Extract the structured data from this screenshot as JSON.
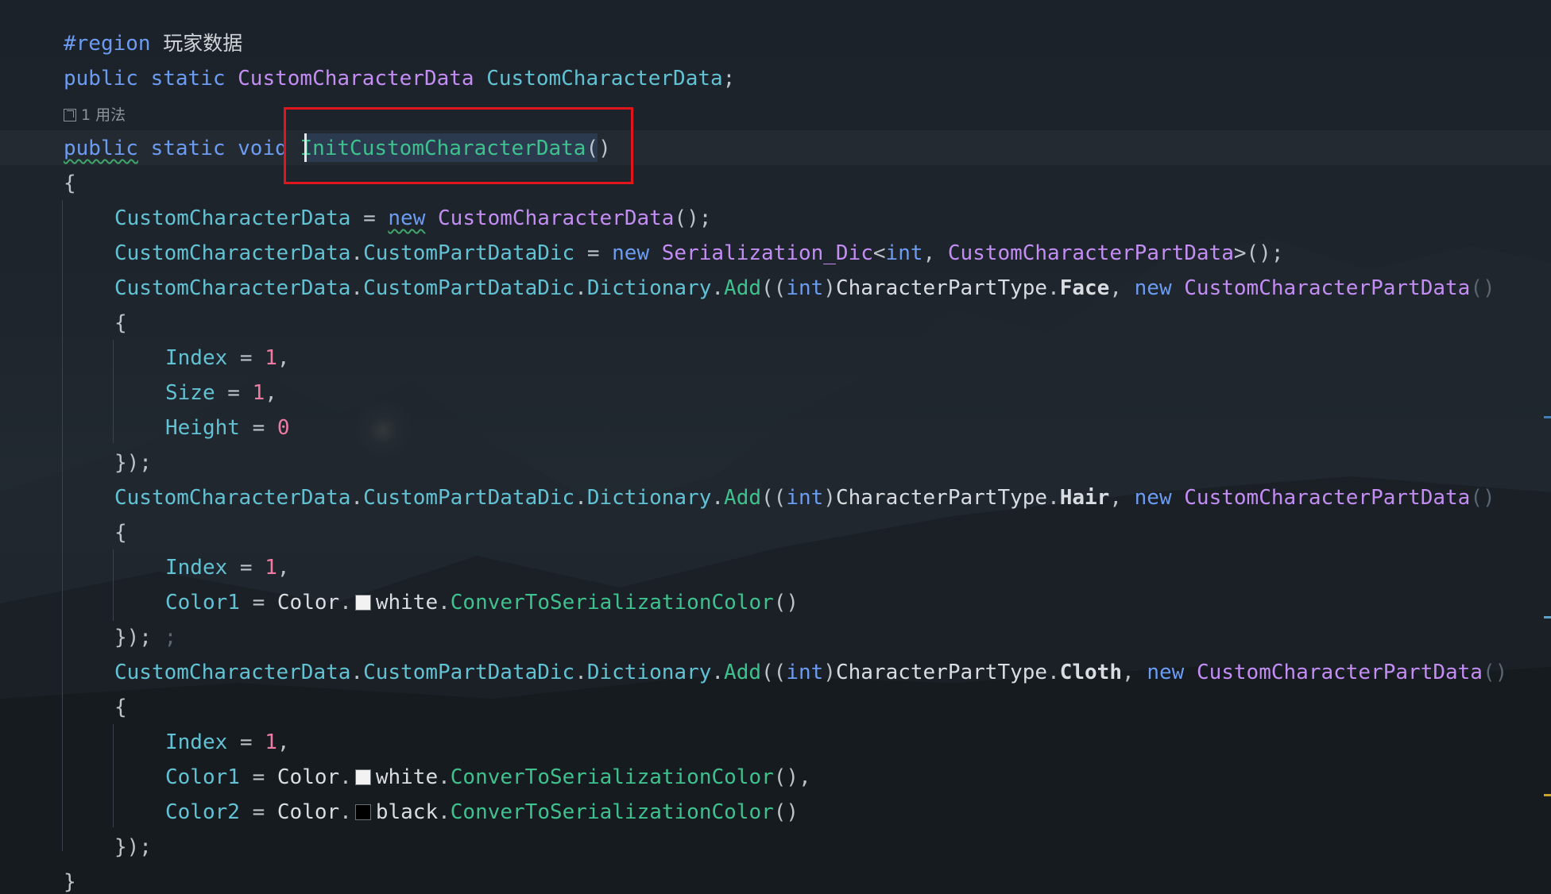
{
  "editor": {
    "region": {
      "directive": "#region",
      "label": "玩家数据"
    },
    "field_decl": {
      "mod1": "public",
      "mod2": "static",
      "type": "CustomCharacterData",
      "name": "CustomCharacterData",
      "end": ";"
    },
    "usage_hint": "1 用法",
    "method_decl": {
      "mod1": "public",
      "mod2": "static",
      "ret": "void",
      "name": "InitCustomCharacterData",
      "parens": "()"
    },
    "open_brace": "{",
    "close_brace": "}",
    "assign_new": {
      "lhs": "CustomCharacterData",
      "op": " = ",
      "kw": "new",
      "type": "CustomCharacterData",
      "end": "();"
    },
    "dic_init": {
      "obj": "CustomCharacterData",
      "dot": ".",
      "prop": "CustomPartDataDic",
      "op": " = ",
      "kw": "new",
      "type": "Serialization_Dic",
      "lt": "<",
      "int": "int",
      "comma": ", ",
      "type2": "CustomCharacterPartData",
      "end": ">();"
    },
    "add_calls": [
      {
        "obj": "CustomCharacterData",
        "prop": "CustomPartDataDic",
        "prop2": "Dictionary",
        "meth": "Add",
        "cast_open": "((",
        "int": "int",
        "cast_close": ")",
        "enum": "CharacterPartType",
        "member": "Face",
        "kw": "new",
        "type": "CustomCharacterPartData",
        "end": "()"
      },
      {
        "obj": "CustomCharacterData",
        "prop": "CustomPartDataDic",
        "prop2": "Dictionary",
        "meth": "Add",
        "cast_open": "((",
        "int": "int",
        "cast_close": ")",
        "enum": "CharacterPartType",
        "member": "Hair",
        "kw": "new",
        "type": "CustomCharacterPartData",
        "end": "()"
      },
      {
        "obj": "CustomCharacterData",
        "prop": "CustomPartDataDic",
        "prop2": "Dictionary",
        "meth": "Add",
        "cast_open": "((",
        "int": "int",
        "cast_close": ")",
        "enum": "CharacterPartType",
        "member": "Cloth",
        "kw": "new",
        "type": "CustomCharacterPartData",
        "end": "()"
      }
    ],
    "face_props": [
      {
        "name": "Index",
        "op": " = ",
        "val": "1",
        "end": ","
      },
      {
        "name": "Size",
        "op": " = ",
        "val": "1",
        "end": ","
      },
      {
        "name": "Height",
        "op": " = ",
        "val": "0",
        "end": ""
      }
    ],
    "hair_props": {
      "index": {
        "name": "Index",
        "op": " = ",
        "val": "1",
        "end": ","
      },
      "color1": {
        "name": "Color1",
        "op": " = ",
        "cls": "Color",
        "dot": ".",
        "color": "white",
        "meth": "ConverToSerializationColor",
        "end": "()"
      }
    },
    "cloth_props": {
      "index": {
        "name": "Index",
        "op": " = ",
        "val": "1",
        "end": ","
      },
      "color1": {
        "name": "Color1",
        "op": " = ",
        "cls": "Color",
        "dot": ".",
        "color": "white",
        "meth": "ConverToSerializationColor",
        "end": "(),"
      },
      "color2": {
        "name": "Color2",
        "op": " = ",
        "cls": "Color",
        "dot": ".",
        "color": "black",
        "meth": "ConverToSerializationColor",
        "end": "()"
      }
    },
    "block_end": "});",
    "block_end_extra": " ;"
  },
  "colors": {
    "keyword": "#6b9cf2",
    "type": "#c38df4",
    "property": "#62c2d4",
    "method": "#3fc18e",
    "number": "#ee7ba4",
    "annotation": "#e0161c"
  }
}
